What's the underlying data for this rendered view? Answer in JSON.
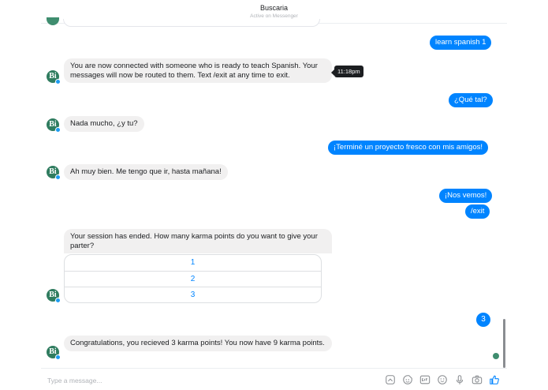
{
  "header": {
    "title": "Buscaria",
    "status": "Active on Messenger"
  },
  "avatar": {
    "initials": "Bi"
  },
  "messages": {
    "m1": "learn spanish 1",
    "m2": "You are now connected with someone who is ready to teach Spanish. Your messages will now be routed to them. Text /exit at any time to exit.",
    "m3": "¿Qué tal?",
    "m4": "Nada mucho, ¿y tu?",
    "m5": "¡Terminé un proyecto fresco con mis amigos!",
    "m6": "Ah muy bien. Me tengo que ir, hasta mañana!",
    "m7": "¡Nos vemos!",
    "m8": "/exit",
    "m9": "Your session has ended. How many karma points do you want to give your parter?",
    "m10": "3",
    "m11": "Congratulations, you recieved 3 karma points! You now have 9 karma points."
  },
  "tooltip": "11:18pm",
  "options": [
    "1",
    "2",
    "3"
  ],
  "composer": {
    "placeholder": "Type a message..."
  },
  "icons": [
    "sticker-icon",
    "emoji-face-icon",
    "gif-icon",
    "smiley-icon",
    "microphone-icon",
    "camera-icon",
    "thumbs-up-icon"
  ],
  "colors": {
    "accent": "#0084ff",
    "incoming_bubble": "#f1f0f0",
    "avatar": "#2f7c5f"
  }
}
